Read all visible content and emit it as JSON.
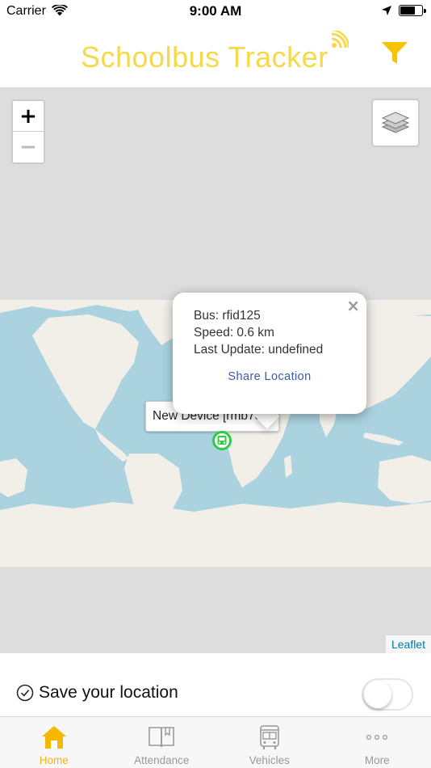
{
  "status_bar": {
    "carrier": "Carrier",
    "time": "9:00 AM",
    "battery_level": 0.75
  },
  "header": {
    "title": "Schoolbus Tracker",
    "accent_color": "#f5d94a",
    "filter_color": "#f5c400"
  },
  "map": {
    "zoom_in": "+",
    "zoom_out": "−",
    "tooltip": "New Device [rmb73b]",
    "popup": {
      "close": "×",
      "bus": "Bus: rfid125",
      "speed": "Speed: 0.6 km",
      "last_update": "Last Update: undefined",
      "share": "Share Location"
    },
    "attribution": "Leaflet"
  },
  "save_location": {
    "label": "Save your location",
    "enabled": false
  },
  "tabs": [
    {
      "label": "Home",
      "icon": "home-icon",
      "active": true
    },
    {
      "label": "Attendance",
      "icon": "book-icon",
      "active": false
    },
    {
      "label": "Vehicles",
      "icon": "bus-icon",
      "active": false
    },
    {
      "label": "More",
      "icon": "more-icon",
      "active": false
    }
  ]
}
